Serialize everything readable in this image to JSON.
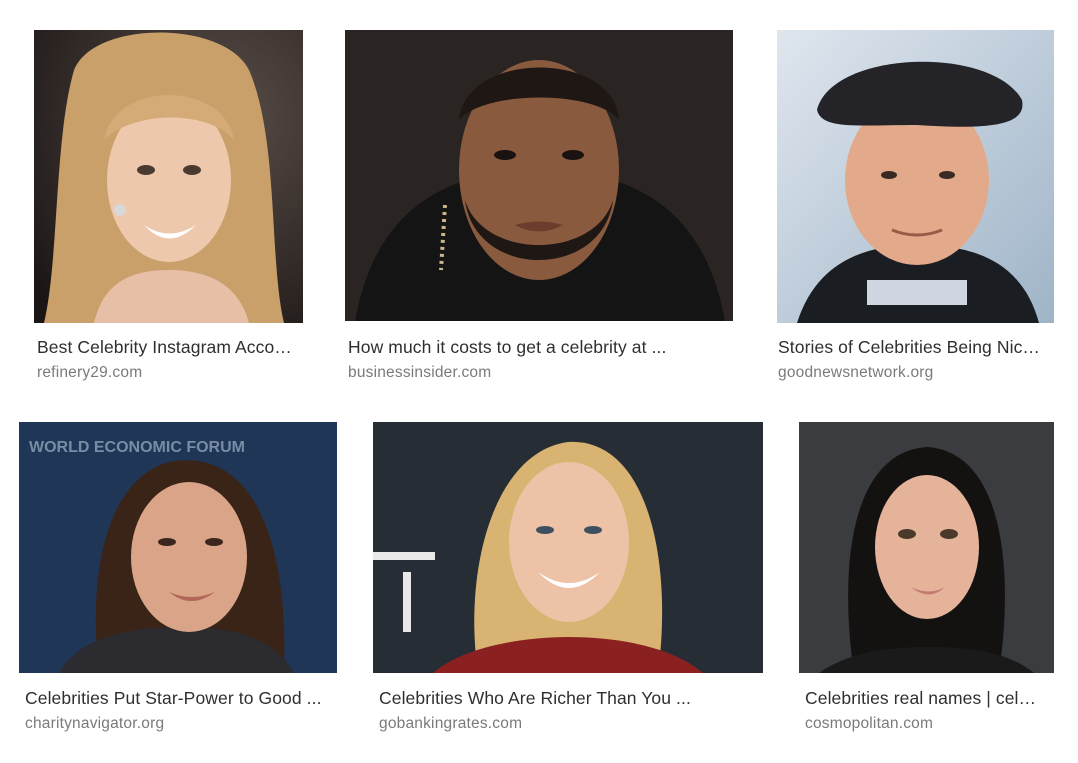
{
  "results": [
    {
      "title": "Best Celebrity Instagram Acco…",
      "source": "refinery29.com",
      "image_alt": "Woman with long wavy blonde hair smiling"
    },
    {
      "title": "How much it costs to get a celebrity at ...",
      "source": "businessinsider.com",
      "image_alt": "Bearded man in black hoodie"
    },
    {
      "title": "Stories of Celebrities Being Nic…",
      "source": "goodnewsnetwork.org",
      "image_alt": "Smiling man in dark flat cap"
    },
    {
      "title": "Celebrities Put Star-Power to Good ...",
      "source": "charitynavigator.org",
      "image_alt": "Woman with dark brown hair at forum"
    },
    {
      "title": "Celebrities Who Are Richer Than You ...",
      "source": "gobankingrates.com",
      "image_alt": "Smiling woman with blonde hair at event"
    },
    {
      "title": "Celebrities real names | cel…",
      "source": "cosmopolitan.com",
      "image_alt": "Woman with dark hair and green-brown eyes"
    }
  ],
  "thumb_text": {
    "forum_backdrop": "WORLD ECONOMIC FORUM"
  }
}
